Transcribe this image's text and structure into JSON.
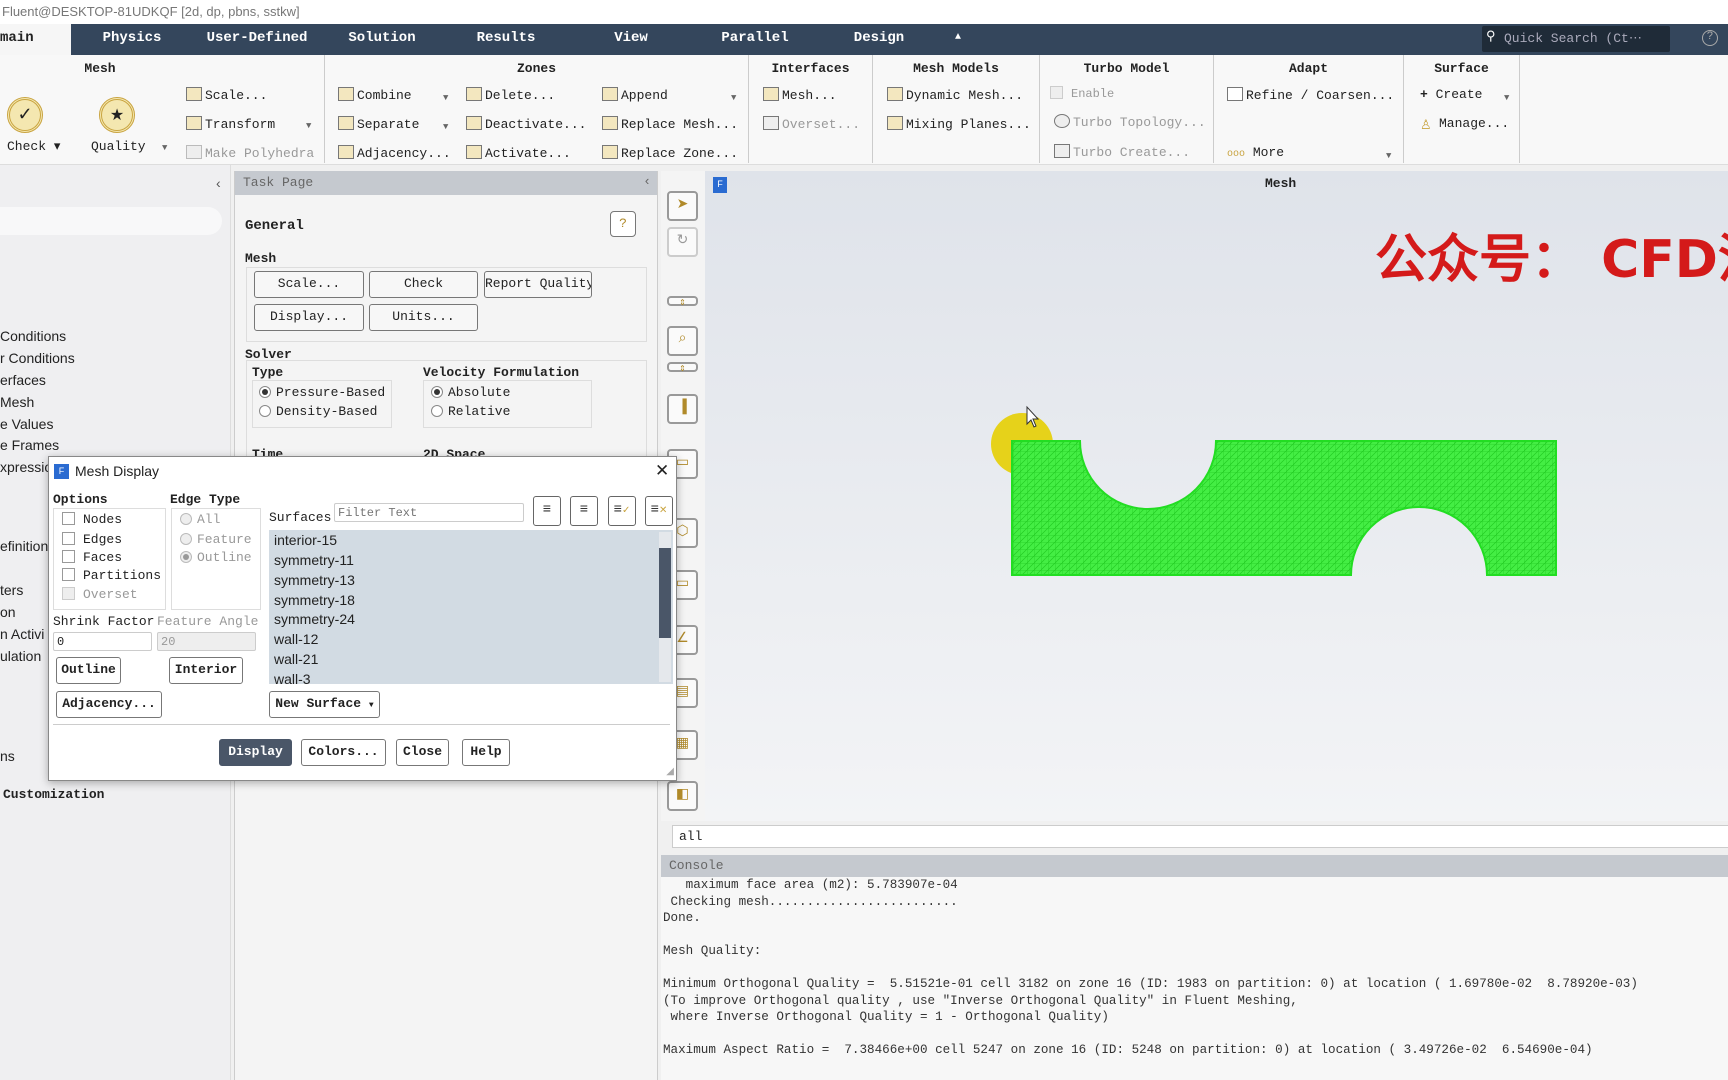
{
  "window": {
    "title": "Fluent@DESKTOP-81UDKQF  [2d, dp, pbns, sstkw]"
  },
  "tabs": [
    "main",
    "Physics",
    "User-Defined",
    "Solution",
    "Results",
    "View",
    "Parallel",
    "Design"
  ],
  "quick_search": {
    "placeholder": "Quick Search (Ct⋯"
  },
  "ribbon": {
    "mesh": {
      "title": "Mesh",
      "check": "Check",
      "quality": "Quality",
      "scale": "Scale...",
      "transform": "Transform",
      "make_polyhedra": "Make Polyhedra"
    },
    "zones": {
      "title": "Zones",
      "combine": "Combine",
      "separate": "Separate",
      "adjacency": "Adjacency...",
      "delete": "Delete...",
      "deactivate": "Deactivate...",
      "activate": "Activate...",
      "append": "Append",
      "replace_mesh": "Replace Mesh...",
      "replace_zone": "Replace Zone..."
    },
    "interfaces": {
      "title": "Interfaces",
      "mesh": "Mesh...",
      "overset": "Overset..."
    },
    "mesh_models": {
      "title": "Mesh Models",
      "dynamic": "Dynamic Mesh...",
      "mixing": "Mixing Planes..."
    },
    "turbo": {
      "title": "Turbo Model",
      "enable": "Enable",
      "topology": "Turbo Topology...",
      "create": "Turbo Create..."
    },
    "adapt": {
      "title": "Adapt",
      "refine": "Refine / Coarsen...",
      "more": "More"
    },
    "surface": {
      "title": "Surface",
      "create": "Create",
      "manage": "Manage..."
    }
  },
  "tree": {
    "items": [
      "Conditions",
      "r Conditions",
      "erfaces",
      "Mesh",
      "e Values",
      "e Frames",
      "xpressio",
      "efinition",
      "ters",
      "on",
      "n Activi",
      "ulation",
      "ns",
      "Customization"
    ]
  },
  "task": {
    "header": "Task Page",
    "title": "General",
    "mesh_label": "Mesh",
    "buttons": [
      "Scale...",
      "Check",
      "Report Quality",
      "Display...",
      "Units..."
    ],
    "solver_label": "Solver",
    "type_label": "Type",
    "types": [
      "Pressure-Based",
      "Density-Based"
    ],
    "type_selected": "Pressure-Based",
    "velocity_label": "Velocity Formulation",
    "velocities": [
      "Absolute",
      "Relative"
    ],
    "velocity_selected": "Absolute",
    "time_label": "Time",
    "space_label": "2D Space"
  },
  "graphics": {
    "title": "Mesh",
    "watermark": "公众号： CFD流",
    "mesh_color": "#33e633"
  },
  "command": {
    "value": "all"
  },
  "console": {
    "header": "Console",
    "lines": [
      "   maximum face area (m2): 5.783907e-04",
      " Checking mesh.........................",
      "Done.",
      "",
      "Mesh Quality:",
      "",
      "Minimum Orthogonal Quality =  5.51521e-01 cell 3182 on zone 16 (ID: 1983 on partition: 0) at location ( 1.69780e-02  8.78920e-03)",
      "(To improve Orthogonal quality , use \"Inverse Orthogonal Quality\" in Fluent Meshing,",
      " where Inverse Orthogonal Quality = 1 - Orthogonal Quality)",
      "",
      "Maximum Aspect Ratio =  7.38466e+00 cell 5247 on zone 16 (ID: 5248 on partition: 0) at location ( 3.49726e-02  6.54690e-04)"
    ]
  },
  "dialog": {
    "title": "Mesh Display",
    "options_label": "Options",
    "options": [
      "Nodes",
      "Edges",
      "Faces",
      "Partitions",
      "Overset"
    ],
    "edge_label": "Edge Type",
    "edges": [
      "All",
      "Feature",
      "Outline"
    ],
    "edge_selected": "Outline",
    "surfaces_label": "Surfaces",
    "filter_placeholder": "Filter Text",
    "surfaces": [
      "interior-15",
      "symmetry-11",
      "symmetry-13",
      "symmetry-18",
      "symmetry-24",
      "wall-12",
      "wall-21",
      "wall-3"
    ],
    "shrink_label": "Shrink Factor",
    "shrink_value": "0",
    "angle_label": "Feature Angle",
    "angle_value": "20",
    "outline": "Outline",
    "interior": "Interior",
    "adjacency": "Adjacency...",
    "new_surface": "New Surface",
    "display": "Display",
    "colors": "Colors...",
    "close": "Close",
    "help": "Help"
  }
}
